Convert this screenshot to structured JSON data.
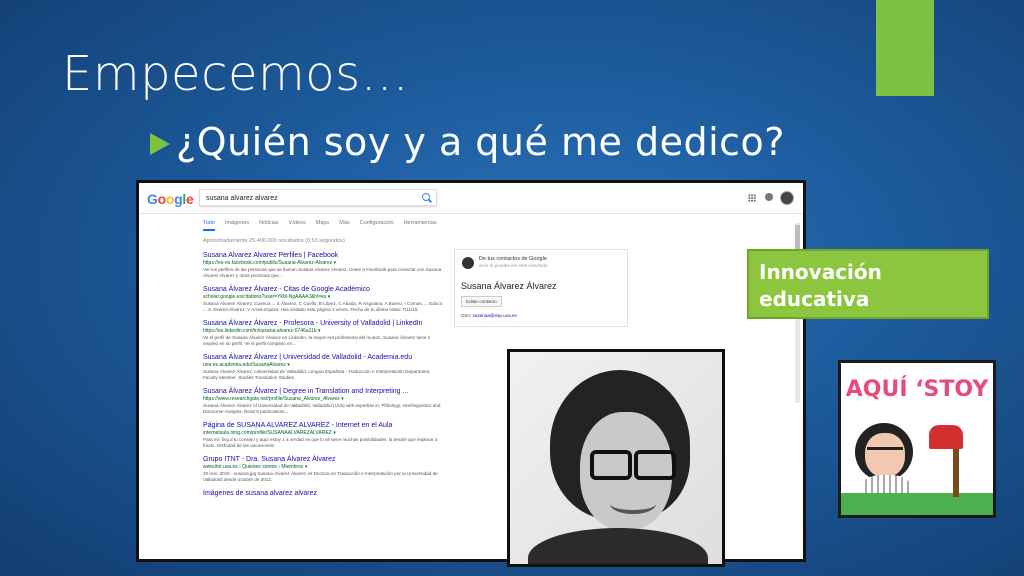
{
  "slide": {
    "title": "Empecemos…",
    "bullet": "¿Quién soy y a qué me dedico?",
    "label": [
      "Innovación",
      "educativa"
    ],
    "sticker_text": "AQUÍ ‘STOY",
    "accent_color": "#7dc242"
  },
  "google": {
    "logo": [
      "G",
      "o",
      "o",
      "g",
      "l",
      "e"
    ],
    "query": "susana alvarez alvarez",
    "tabs": [
      "Todo",
      "Imágenes",
      "Noticias",
      "Vídeos",
      "Maps",
      "Más",
      "Configuración",
      "Herramientas"
    ],
    "result_count": "Aproximadamente 25.400.000 resultados (0,53 segundos)",
    "results": [
      {
        "title": "Susana Alvarez Alvarez Perfiles | Facebook",
        "url": "https://es-es.facebook.com/public/Susana-Alvarez-Alvarez ▾",
        "snippet": "Ver los perfiles de las personas que se llaman Susana Alvarez Alvarez. Únete a Facebook para conectar con Susana Alvarez Alvarez y otras personas que..."
      },
      {
        "title": "Susana Álvarez Álvarez - Citas de Google Académico",
        "url": "scholar.google.es/citations?user=YkM-NgAAAAJ&hl=es ▾",
        "snippet": "Susana Álvarez Álvarez. Cuenca ... S Álvarez, C Cuéllo, B López, C Abada, R Angulano, A Bueno, I Comas, ... Educo ... S Álvarez-Álvarez, V Arnal-Izquiza. Has visitado esta página 1 veces. Fecha de tu última visita: 7/11/18."
      },
      {
        "title": "Susana Álvarez Álvarez - Profesora - University of Valladolid | LinkedIn",
        "url": "https://es.linkedin.com/in/susana-alvarez-0746a11b ▾",
        "snippet": "Ve el perfil de Susana Álvarez Álvarez en LinkedIn, la mayor red profesional del mundo. Susana Álvarez tiene 1 empleo en su perfil. Ve el perfil completo en..."
      },
      {
        "title": "Susana Álvarez Álvarez | Universidad de Valladolid - Academia.edu",
        "url": "uva-es.academia.edu/SusanaAlvarez ▾",
        "snippet": "Susana Álvarez Álvarez, Universidad de Valladolid, Lengua Española - Traducción e Interpretación Department, Faculty Member. Studies Translation Studies."
      },
      {
        "title": "Susana Álvarez Álvarez | Degree in Translation and Interpreting ...",
        "url": "https://www.researchgate.net/profile/Susana_Alvarez_Alvarez ▾",
        "snippet": "Susana Álvarez Álvarez of Universidad de Valladolid, Valladolid (UVa) with expertise in: Philology, Interlinguistics and Discourse Analysis. Read 8 publications..."
      },
      {
        "title": "Página de SUSANA ALVAREZ ALVAREZ - Internet en el Aula",
        "url": "internetaula.ning.com/profile/SUSANAALVAREZALVAREZ ▾",
        "snippet": "Para mí, ling.d tu consejo y aquí estoy 1 a verdad es que lo sé tiene muchas posibilidades, la tendré que explorar a fondo. Disfrutad de las vacaciones!"
      },
      {
        "title": "Grupo ITNT - Dra. Susana Álvarez Álvarez",
        "url": "www.itnt.uva.es › Quienes somos › Miembros ▾",
        "snippet": "20 ene. 2015 - susana.jpg Susana Álvarez Álvarez es Doctora en Traducción e Interpretación por la Universidad de Valladolid desde octubre de 2012."
      },
      {
        "title": "Imágenes de susana alvarez alvarez",
        "url": "",
        "snippet": ""
      }
    ],
    "knowledge_panel": {
      "subtitle": "De tus contactos de Google",
      "note": "Solo tú puedes ver este resultado",
      "name": "Susana Álvarez Álvarez",
      "button": "Editar contacto",
      "email_label": "Otro:",
      "email": "susanaa@esp.uva.es"
    }
  }
}
